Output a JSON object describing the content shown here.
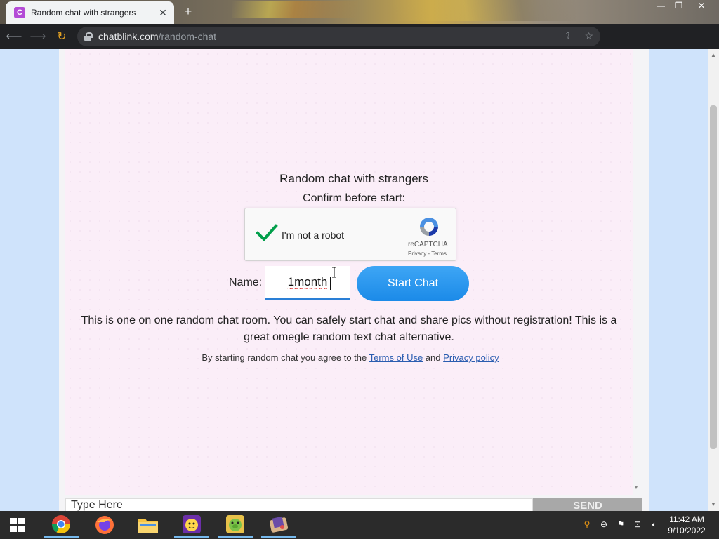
{
  "browser": {
    "tab_title": "Random chat with strangers",
    "tab_favicon_letter": "C",
    "url_host": "chatblink.com",
    "url_path": "/random-chat"
  },
  "page": {
    "heading": "Random chat with strangers",
    "confirm_text": "Confirm before start:",
    "recaptcha": {
      "label": "I'm not a robot",
      "brand": "reCAPTCHA",
      "links": "Privacy - Terms",
      "checked": true
    },
    "name_label": "Name:",
    "name_value": "1month",
    "start_button": "Start Chat",
    "description": "This is one on one random chat room. You can safely start chat and share pics without registration! This is a great omegle random text chat alternative.",
    "agree_prefix": "By starting random chat you agree to the",
    "terms_link": "Terms of Use",
    "agree_and": "and",
    "privacy_link": "Privacy policy",
    "composer_placeholder": "Type Here",
    "send_button": "SEND"
  },
  "taskbar": {
    "clock_time": "11:42 AM",
    "clock_date": "9/10/2022",
    "apps": [
      "chrome-icon",
      "firefox-icon",
      "file-explorer-icon",
      "yahoo-messenger-icon",
      "game-pig-icon",
      "app-icon"
    ]
  },
  "colors": {
    "accent_blue": "#1b8ae8",
    "panel_pink": "#fbeef8",
    "page_bg": "#cfe3fb",
    "check_green": "#029f4b"
  }
}
